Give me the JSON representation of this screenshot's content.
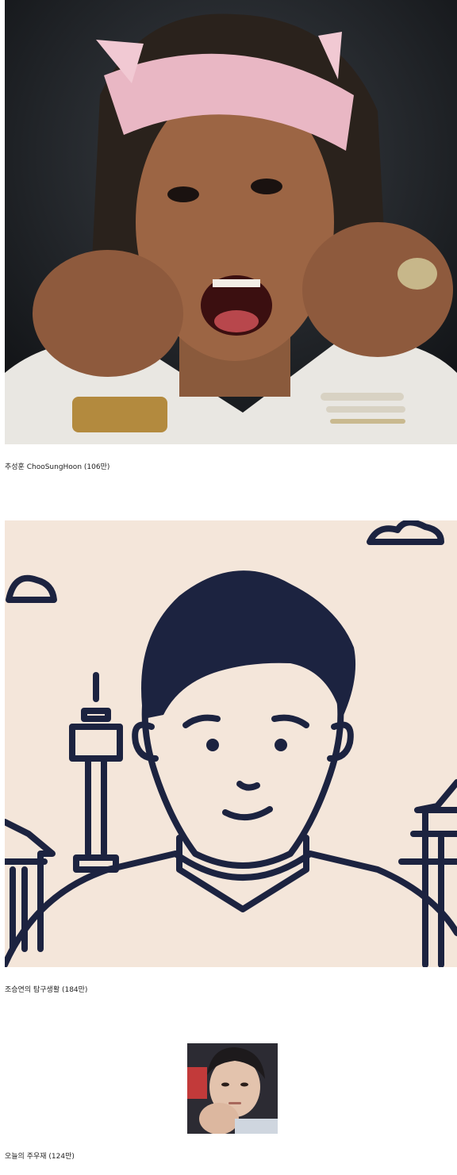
{
  "posts": [
    {
      "caption": "추성훈 ChooSungHoon (106만)",
      "image_subject": "man-with-pink-cat-ear-headband-photo"
    },
    {
      "caption": "조승연의 탐구생활 (184만)",
      "image_subject": "illustrated-man-avatar-with-seoul-skyline",
      "colors": {
        "background": "#f4e6da",
        "line": "#1c2340"
      }
    },
    {
      "caption": "오늘의 주우재 (124만)",
      "image_subject": "selfie-portrait-thumbnail"
    }
  ]
}
